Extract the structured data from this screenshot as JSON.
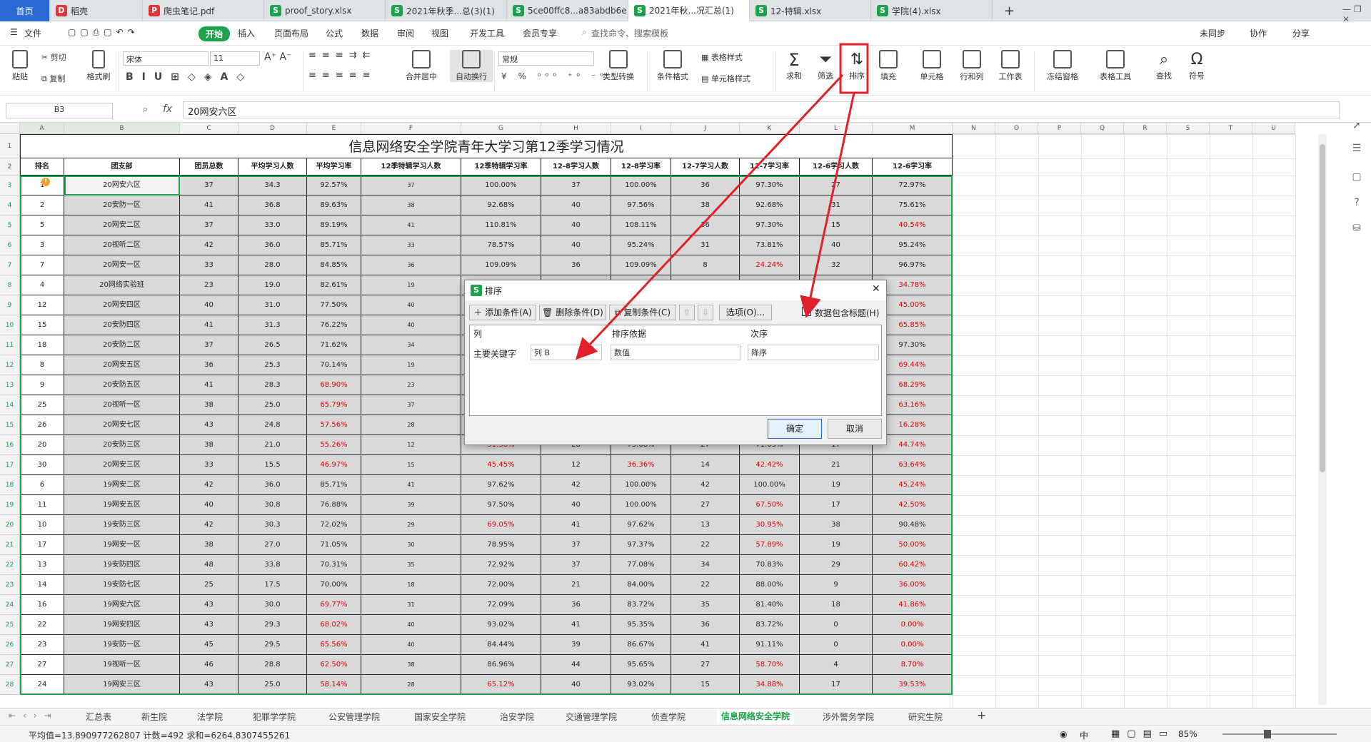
{
  "tabs": [
    {
      "label": "首页",
      "icon": "",
      "color": "#2c6ad8"
    },
    {
      "label": "稻壳",
      "icon": "D",
      "color": "#e0363a"
    },
    {
      "label": "爬虫笔记.pdf",
      "icon": "P",
      "color": "#e0363a"
    },
    {
      "label": "proof_story.xlsx",
      "icon": "S",
      "color": "#1aa34a"
    },
    {
      "label": "2021年秋季...总(3)(1)",
      "icon": "S",
      "color": "#1aa34a"
    },
    {
      "label": "5ce00ffc8...a83abdb6e",
      "icon": "S",
      "color": "#1aa34a"
    },
    {
      "label": "2021年秋...况汇总(1)",
      "icon": "S",
      "color": "#1aa34a"
    },
    {
      "label": "12-特辑.xlsx",
      "icon": "S",
      "color": "#1aa34a"
    },
    {
      "label": "学院(4).xlsx",
      "icon": "S",
      "color": "#1aa34a"
    }
  ],
  "tab_plus": "+",
  "menu": {
    "file": "文件",
    "items": [
      "开始",
      "插入",
      "页面布局",
      "公式",
      "数据",
      "审阅",
      "视图",
      "开发工具",
      "会员专享"
    ],
    "search": "查找命令、搜索模板",
    "right": [
      "未同步",
      "协作",
      "分享"
    ]
  },
  "ribbon": {
    "paste": "粘贴",
    "cut": "剪切",
    "copy": "复制",
    "format_painter": "格式刷",
    "font_name": "宋体",
    "font_size": "11",
    "merge": "合并居中",
    "wrap": "自动换行",
    "number_format": "常规",
    "convert": "类型转换",
    "cond_format": "条件格式",
    "table_style": "表格样式",
    "cell_style": "单元格样式",
    "sum": "求和",
    "filter": "筛选",
    "sort": "排序",
    "fill": "填充",
    "cell": "单元格",
    "rowcol": "行和列",
    "sheet": "工作表",
    "freeze": "冻结窗格",
    "table_tools": "表格工具",
    "find": "查找",
    "symbol": "符号"
  },
  "formula_bar": {
    "name_box": "B3",
    "fx": "fx",
    "content": "20网安六区"
  },
  "columns": [
    "A",
    "B",
    "C",
    "D",
    "E",
    "F",
    "G",
    "H",
    "I",
    "J",
    "K",
    "L",
    "M",
    "N",
    "O",
    "P",
    "Q",
    "R",
    "S",
    "T",
    "U"
  ],
  "sheet_title": "信息网络安全学院青年大学习第12季学习情况",
  "headers": [
    "排名",
    "团支部",
    "团员总数",
    "平均学习人数",
    "平均学习率",
    "12季特辑学习人数",
    "12季特辑学习率",
    "12-8学习人数",
    "12-8学习率",
    "12-7学习人数",
    "12-7学习率",
    "12-6学习人数",
    "12-6学习率"
  ],
  "rows": [
    [
      "1",
      "20网安六区",
      "37",
      "34.3",
      "92.57%",
      "37",
      "100.00%",
      "37",
      "100.00%",
      "36",
      "97.30%",
      "27",
      "72.97%"
    ],
    [
      "2",
      "20安防一区",
      "41",
      "36.8",
      "89.63%",
      "38",
      "92.68%",
      "40",
      "97.56%",
      "38",
      "92.68%",
      "31",
      "75.61%"
    ],
    [
      "5",
      "20网安二区",
      "37",
      "33.0",
      "89.19%",
      "41",
      "110.81%",
      "40",
      "108.11%",
      "36",
      "97.30%",
      "15",
      "40.54%"
    ],
    [
      "3",
      "20视听二区",
      "42",
      "36.0",
      "85.71%",
      "33",
      "78.57%",
      "40",
      "95.24%",
      "31",
      "73.81%",
      "40",
      "95.24%"
    ],
    [
      "7",
      "20网安一区",
      "33",
      "28.0",
      "84.85%",
      "36",
      "109.09%",
      "36",
      "109.09%",
      "8",
      "24.24%",
      "32",
      "96.97%"
    ],
    [
      "4",
      "20网络实验班",
      "23",
      "19.0",
      "82.61%",
      "19",
      "",
      "",
      "",
      "",
      "",
      "",
      "34.78%"
    ],
    [
      "12",
      "20网安四区",
      "40",
      "31.0",
      "77.50%",
      "40",
      "",
      "",
      "",
      "",
      "",
      "",
      "45.00%"
    ],
    [
      "15",
      "20安防四区",
      "41",
      "31.3",
      "76.22%",
      "40",
      "",
      "",
      "",
      "",
      "",
      "",
      "65.85%"
    ],
    [
      "18",
      "20安防二区",
      "37",
      "26.5",
      "71.62%",
      "34",
      "",
      "",
      "",
      "",
      "",
      "",
      "97.30%"
    ],
    [
      "8",
      "20网安五区",
      "36",
      "25.3",
      "70.14%",
      "19",
      "",
      "",
      "",
      "",
      "",
      "",
      "69.44%"
    ],
    [
      "9",
      "20安防五区",
      "41",
      "28.3",
      "68.90%",
      "23",
      "",
      "",
      "",
      "",
      "",
      "",
      "68.29%"
    ],
    [
      "25",
      "20视听一区",
      "38",
      "25.0",
      "65.79%",
      "37",
      "",
      "",
      "",
      "",
      "",
      "",
      "63.16%"
    ],
    [
      "26",
      "20网安七区",
      "43",
      "24.8",
      "57.56%",
      "28",
      "",
      "",
      "",
      "",
      "",
      "",
      "16.28%"
    ],
    [
      "20",
      "20安防三区",
      "38",
      "21.0",
      "55.26%",
      "12",
      "31.58%",
      "28",
      "73.68%",
      "27",
      "71.05%",
      "17",
      "44.74%"
    ],
    [
      "30",
      "20网安三区",
      "33",
      "15.5",
      "46.97%",
      "15",
      "45.45%",
      "12",
      "36.36%",
      "14",
      "42.42%",
      "21",
      "63.64%"
    ],
    [
      "6",
      "19网安二区",
      "42",
      "36.0",
      "85.71%",
      "41",
      "97.62%",
      "42",
      "100.00%",
      "42",
      "100.00%",
      "19",
      "45.24%"
    ],
    [
      "11",
      "19网安五区",
      "40",
      "30.8",
      "76.88%",
      "39",
      "97.50%",
      "40",
      "100.00%",
      "27",
      "67.50%",
      "17",
      "42.50%"
    ],
    [
      "10",
      "19安防三区",
      "42",
      "30.3",
      "72.02%",
      "29",
      "69.05%",
      "41",
      "97.62%",
      "13",
      "30.95%",
      "38",
      "90.48%"
    ],
    [
      "17",
      "19网安一区",
      "38",
      "27.0",
      "71.05%",
      "30",
      "78.95%",
      "37",
      "97.37%",
      "22",
      "57.89%",
      "19",
      "50.00%"
    ],
    [
      "13",
      "19安防四区",
      "48",
      "33.8",
      "70.31%",
      "35",
      "72.92%",
      "37",
      "77.08%",
      "34",
      "70.83%",
      "29",
      "60.42%"
    ],
    [
      "14",
      "19安防七区",
      "25",
      "17.5",
      "70.00%",
      "18",
      "72.00%",
      "21",
      "84.00%",
      "22",
      "88.00%",
      "9",
      "36.00%"
    ],
    [
      "16",
      "19网安六区",
      "43",
      "30.0",
      "69.77%",
      "31",
      "72.09%",
      "36",
      "83.72%",
      "35",
      "81.40%",
      "18",
      "41.86%"
    ],
    [
      "22",
      "19网安四区",
      "43",
      "29.3",
      "68.02%",
      "40",
      "93.02%",
      "41",
      "95.35%",
      "36",
      "83.72%",
      "0",
      "0.00%"
    ],
    [
      "23",
      "19安防一区",
      "45",
      "29.5",
      "65.56%",
      "40",
      "84.44%",
      "39",
      "86.67%",
      "41",
      "91.11%",
      "0",
      "0.00%"
    ],
    [
      "27",
      "19视听一区",
      "46",
      "28.8",
      "62.50%",
      "38",
      "86.96%",
      "44",
      "95.65%",
      "27",
      "58.70%",
      "4",
      "8.70%"
    ],
    [
      "24",
      "19网安三区",
      "43",
      "25.0",
      "58.14%",
      "28",
      "65.12%",
      "40",
      "93.02%",
      "15",
      "34.88%",
      "17",
      "39.53%"
    ]
  ],
  "row_numbers": [
    "1",
    "2",
    "3",
    "4",
    "5",
    "6",
    "7",
    "8",
    "9",
    "10",
    "11",
    "12",
    "13",
    "14",
    "15",
    "16",
    "17",
    "18",
    "19",
    "20",
    "21",
    "22",
    "23",
    "24",
    "25",
    "26",
    "27",
    "28"
  ],
  "dialog": {
    "title": "排序",
    "add": "添加条件(A)",
    "delete": "删除条件(D)",
    "copy": "复制条件(C)",
    "options": "选项(O)...",
    "has_header": "数据包含标题(H)",
    "col_header": "列",
    "basis_header": "排序依据",
    "order_header": "次序",
    "key_label": "主要关键字",
    "key_value": "列 B",
    "basis_value": "数值",
    "order_value": "降序",
    "ok": "确定",
    "cancel": "取消"
  },
  "sheet_tabs": [
    "汇总表",
    "新生院",
    "法学院",
    "犯罪学学院",
    "公安管理学院",
    "国家安全学院",
    "治安学院",
    "交通管理学院",
    "侦查学院",
    "信息网络安全学院",
    "涉外警务学院",
    "研究生院"
  ],
  "active_sheet": "信息网络安全学院",
  "status": {
    "text": "平均值=13.890977262807  计数=492  求和=6264.8307455261",
    "zoom": "85%",
    "lang": "中"
  },
  "colors": {
    "red_text": "#e00000",
    "accent_green": "#1aa34a",
    "annotation_red": "#e0202a"
  }
}
